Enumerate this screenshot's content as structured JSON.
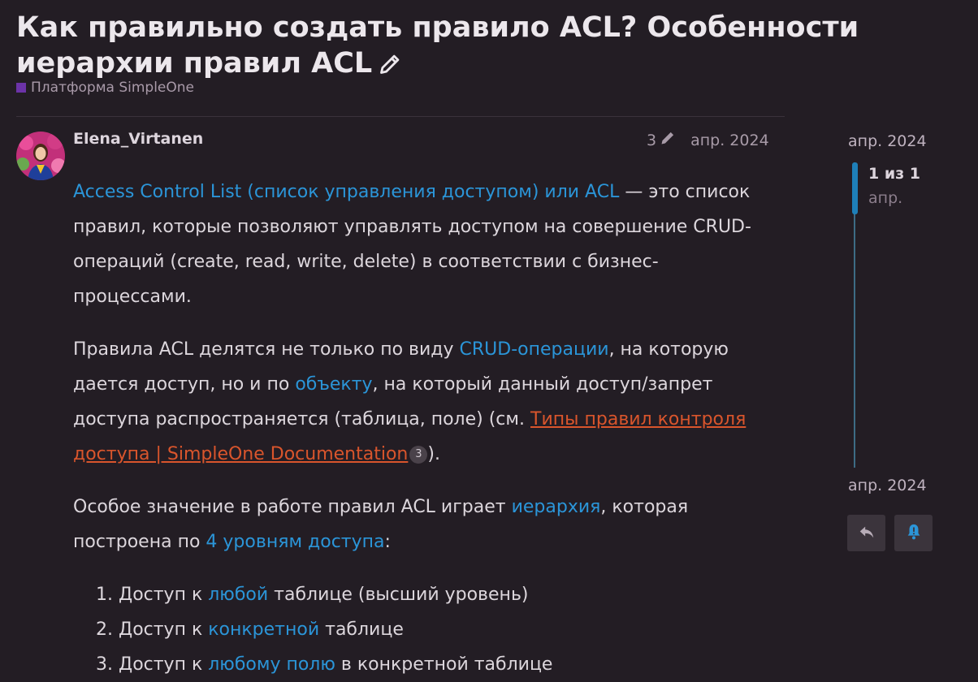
{
  "topic": {
    "title": "Как правильно создать правило ACL? Особенности иерархии правил ACL",
    "category": "Платформа SimpleOne",
    "category_color": "#6c33a8"
  },
  "post": {
    "author": "Elena_Virtanen",
    "edit_count": "3",
    "date": "апр. 2024",
    "p1": {
      "link": "Access Control List (список управления доступом) или ACL",
      "text": " — это список правил, которые позволяют управлять доступом на совершение CRUD-операций (create, read, write, delete) в соответствии с бизнес-процессами."
    },
    "p2": {
      "t1": "Правила ACL делятся не только по виду ",
      "l1": "CRUD-операции",
      "t2": ", на которую дается доступ, но и по ",
      "l2": "объекту",
      "t3": ", на который данный доступ/запрет доступа распространяется (таблица, поле) (см. ",
      "ext_link": "Типы правил контроля доступа | SimpleOne Documentation",
      "ext_clicks": "3",
      "t4": ")."
    },
    "p3": {
      "t1": "Особое значение в работе правил ACL играет ",
      "l1": "иерархия",
      "t2": ", которая построена по ",
      "l2": "4 уровням доступа",
      "t3": ":"
    },
    "list": [
      {
        "pre": "Доступ к ",
        "link": "любой",
        "post": " таблице (высший уровень)"
      },
      {
        "pre": "Доступ к ",
        "link": "конкретной",
        "post": " таблице"
      },
      {
        "pre": "Доступ к ",
        "link": "любому полю",
        "post": " в конкретной таблице"
      }
    ]
  },
  "timeline": {
    "start_date": "апр. 2024",
    "position": "1 из 1",
    "position_date": "апр.",
    "end_date": "апр. 2024"
  },
  "colors": {
    "background": "#231d24",
    "link": "#2b95d8",
    "external_link": "#d9552c",
    "timeline": "#1e7fb8"
  },
  "icons": [
    "pencil-icon",
    "reply-icon",
    "bell-alert-icon"
  ]
}
